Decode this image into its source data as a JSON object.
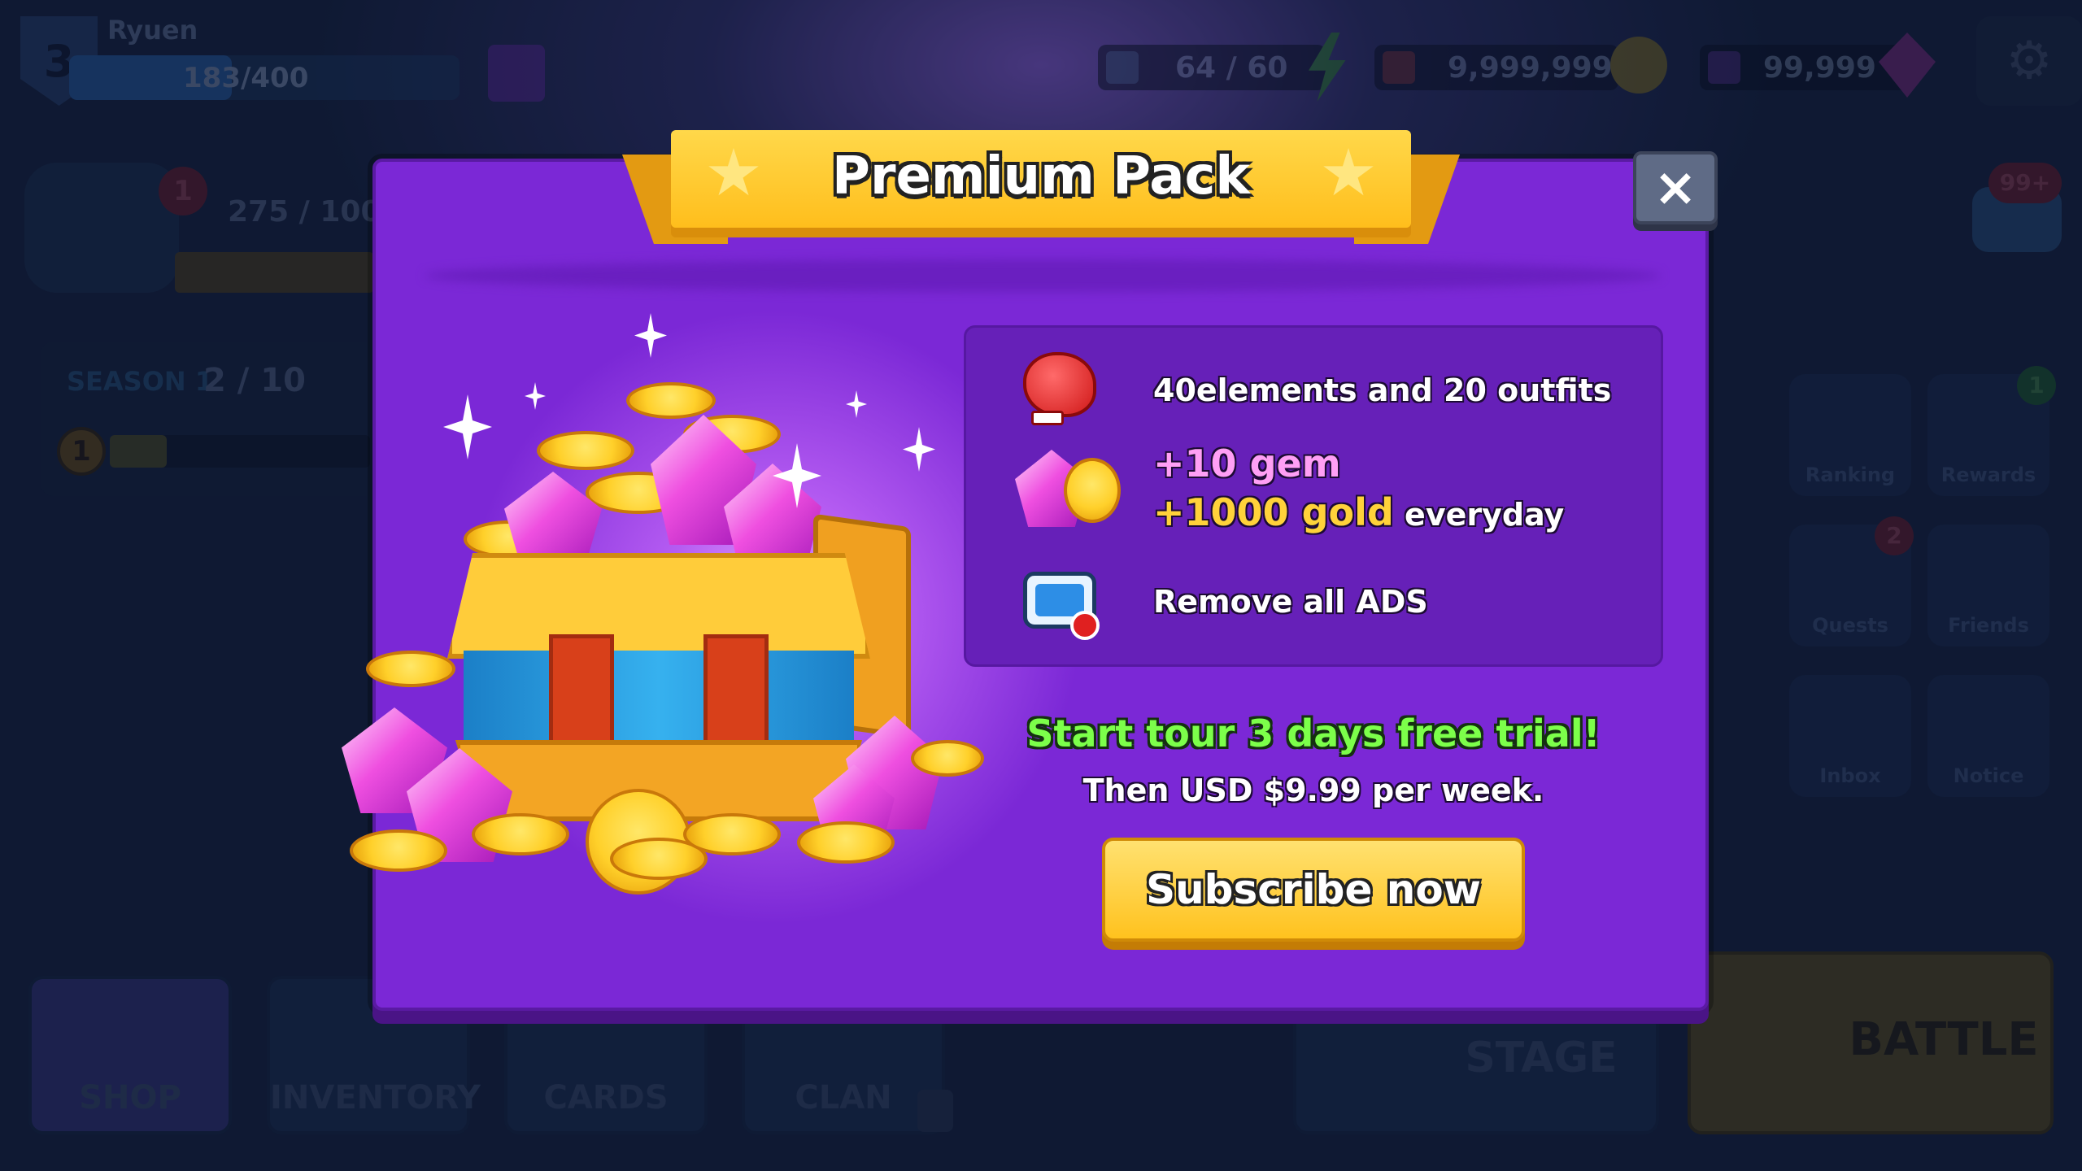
{
  "hud": {
    "level": "3",
    "player_name": "Ryuen",
    "xp": "183/400",
    "energy": "64 / 60",
    "gold": "9,999,999",
    "gems": "99,999",
    "trophy": "275 / 100",
    "badge_count": "1",
    "chat_badge": "99+",
    "season_label": "SEASON 1",
    "season_progress": "2 / 10",
    "season_level": "1"
  },
  "side_menu": [
    {
      "label": "Ranking",
      "badge": ""
    },
    {
      "label": "Rewards",
      "badge": "1"
    },
    {
      "label": "Quests",
      "badge": "2"
    },
    {
      "label": "Friends",
      "badge": ""
    },
    {
      "label": "Inbox",
      "badge": ""
    },
    {
      "label": "Notice",
      "badge": ""
    }
  ],
  "bottom_nav": {
    "shop": "SHOP",
    "inventory": "INVENTORY",
    "cards": "CARDS",
    "clan": "CLAN",
    "stage": "STAGE",
    "battle": "BATTLE"
  },
  "modal": {
    "title": "Premium Pack",
    "close": "×",
    "features": {
      "f1": "40elements and 20 outfits",
      "f2_gem": "+10 gem",
      "f2_gold": "+1000 gold",
      "f2_suffix": "everyday",
      "f3": "Remove all ADS"
    },
    "trial": "Start tour 3 days free trial!",
    "price": "Then USD $9.99 per week.",
    "subscribe": "Subscribe now"
  },
  "icons": {
    "boxing-glove": "boxing-glove-icon",
    "gem-coin": "gem-coin-icon",
    "no-ads": "no-ads-icon",
    "settings": "gear-icon"
  },
  "colors": {
    "modal_bg": "#7b28d6",
    "banner": "#ffc21e",
    "trial_text": "#7cff4a",
    "gem_text": "#ff9ff5",
    "gold_text": "#ffd23a"
  }
}
